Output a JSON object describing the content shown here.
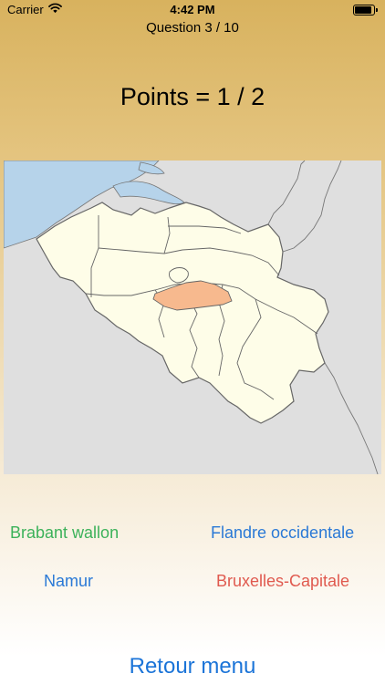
{
  "status_bar": {
    "carrier": "Carrier",
    "time": "4:42 PM",
    "battery_level": 1.0,
    "wifi_icon": "wifi-icon",
    "battery_icon": "battery-icon"
  },
  "quiz": {
    "question_label": "Question 3 / 10",
    "points_label": "Points = 1 / 2"
  },
  "map": {
    "highlight_color": "#f7b98e",
    "region_color": "#fefde8",
    "sea_color": "#b6d3ea",
    "outside_color": "#dfdfdf"
  },
  "answers": [
    {
      "label": "Brabant wallon",
      "color": "#3cb25a"
    },
    {
      "label": "Flandre occidentale",
      "color": "#2a79d6"
    },
    {
      "label": "Namur",
      "color": "#2a79d6"
    },
    {
      "label": "Bruxelles-Capitale",
      "color": "#e05a4f"
    }
  ],
  "footer": {
    "menu_label": "Retour menu"
  }
}
